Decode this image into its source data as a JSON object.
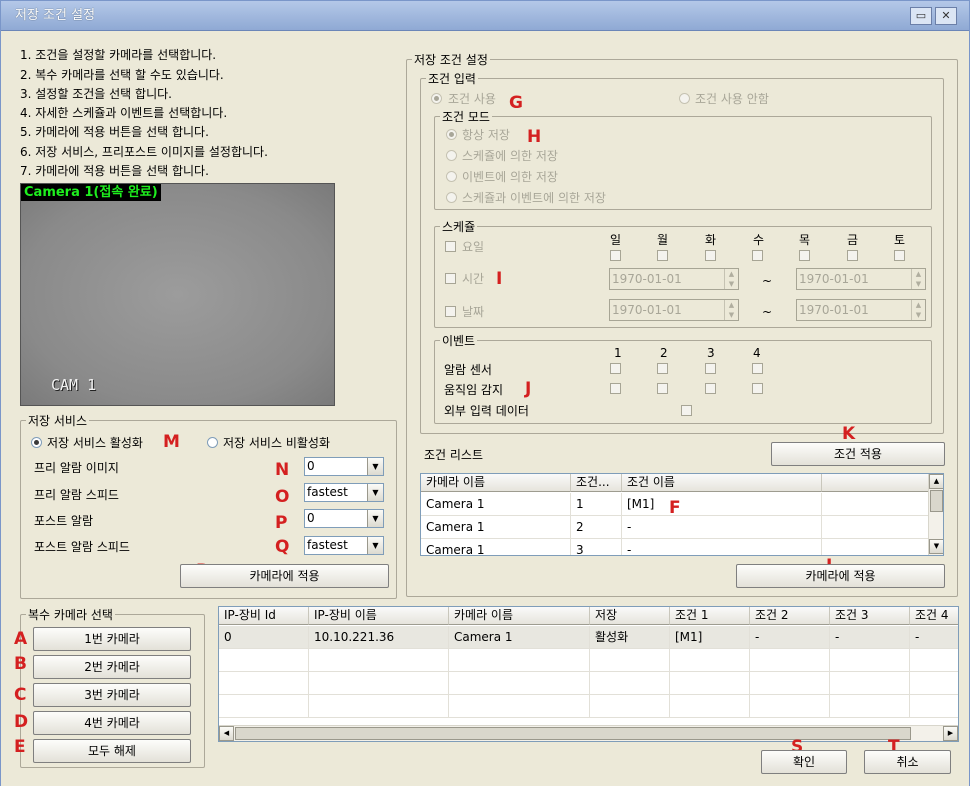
{
  "window": {
    "title": "저장 조건 설정",
    "min_glyph": "▭",
    "close_glyph": "✕"
  },
  "instructions": [
    "1. 조건을 설정할 카메라를 선택합니다.",
    "2. 복수 카메라를 선택 할 수도 있습니다.",
    "3. 설정할 조건을 선택 합니다.",
    "4. 자세한 스케쥴과 이벤트를 선택합니다.",
    "5. 카메라에 적용 버튼을 선택 합니다.",
    "6. 저장 서비스, 프리포스트 이미지를 설정합니다.",
    "7. 카메라에 적용 버튼을 선택 합니다."
  ],
  "camera_view": {
    "label": "Camera 1(접속 완료)",
    "osd": "CAM 1"
  },
  "save_service": {
    "title": "저장 서비스",
    "enable_label": "저장 서비스 활성화",
    "disable_label": "저장 서비스 비활성화",
    "selected": "enable",
    "pre_alarm_image_label": "프리 알람 이미지",
    "pre_alarm_image_value": "0",
    "pre_alarm_speed_label": "프리 알람 스피드",
    "pre_alarm_speed_value": "fastest",
    "post_alarm_label": "포스트 알람",
    "post_alarm_value": "0",
    "post_alarm_speed_label": "포스트 알람 스피드",
    "post_alarm_speed_value": "fastest",
    "apply_button": "카메라에 적용"
  },
  "multi_camera": {
    "title": "복수 카메라 선택",
    "buttons": [
      "1번 카메라",
      "2번 카메라",
      "3번 카메라",
      "4번 카메라",
      "모두 해제"
    ]
  },
  "condition_settings": {
    "title": "저장 조건 설정",
    "input_group_title": "조건 입력",
    "use_label": "조건 사용",
    "not_use_label": "조건 사용 안함",
    "mode_title": "조건 모드",
    "modes": [
      "항상 저장",
      "스케쥴에 의한 저장",
      "이벤트에 의한 저장",
      "스케쥴과 이벤트에 의한 저장"
    ],
    "schedule_title": "스케쥴",
    "days": [
      "일",
      "월",
      "화",
      "수",
      "목",
      "금",
      "토"
    ],
    "weekday_label": "요일",
    "time_label": "시간",
    "date_label": "날짜",
    "time_from": "1970-01-01",
    "time_to": "1970-01-01",
    "date_from": "1970-01-01",
    "date_to": "1970-01-01",
    "tilde": "~",
    "event_title": "이벤트",
    "event_columns": [
      "1",
      "2",
      "3",
      "4"
    ],
    "alarm_sensor_label": "알람 센서",
    "motion_label": "움직임 감지",
    "external_input_label": "외부 입력 데이터",
    "list_label": "조건 리스트",
    "apply_condition_button": "조건 적용",
    "apply_camera_button": "카메라에 적용"
  },
  "condition_list": {
    "headers": [
      "카메라 이름",
      "조건...",
      "조건 이름",
      ""
    ],
    "rows": [
      [
        "Camera 1",
        "1",
        "[M1]",
        ""
      ],
      [
        "Camera 1",
        "2",
        "-",
        ""
      ],
      [
        "Camera 1",
        "3",
        "-",
        ""
      ]
    ]
  },
  "device_table": {
    "headers": [
      "IP-장비 Id",
      "IP-장비 이름",
      "카메라 이름",
      "저장",
      "조건 1",
      "조건 2",
      "조건 3",
      "조건 4"
    ],
    "rows": [
      [
        "0",
        "10.10.221.36",
        "Camera 1",
        "활성화",
        "[M1]",
        "-",
        "-",
        "-"
      ]
    ]
  },
  "footer": {
    "ok_button": "확인",
    "cancel_button": "취소"
  },
  "markers": {
    "A": "A",
    "B": "B",
    "C": "C",
    "D": "D",
    "E": "E",
    "F": "F",
    "G": "G",
    "H": "H",
    "I": "I",
    "J": "J",
    "K": "K",
    "L": "L",
    "M": "M",
    "N": "N",
    "O": "O",
    "P": "P",
    "Q": "Q",
    "R": "R",
    "S": "S",
    "T": "T"
  },
  "colors": {
    "marker": "#d42020",
    "window_bg": "#ece9d8",
    "selected_row": "#e8e7e0",
    "camera_label": "#1eef1e"
  }
}
